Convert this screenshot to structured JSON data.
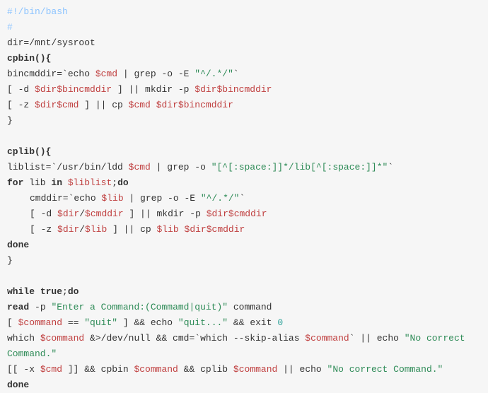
{
  "code": {
    "l1_shebang": "#!/bin/bash",
    "l2_comment": "#",
    "l3a": "dir=",
    "l3b": "/mnt/sysroot",
    "l4": "cpbin(){",
    "l5a": "bincmddir=",
    "l5b": "`echo ",
    "l5c": "$cmd",
    "l5d": " | grep -o -E ",
    "l5e": "\"^/.*/\"",
    "l5f": "`",
    "l6a": "[ -d ",
    "l6b": "$dir$bincmddir",
    "l6c": " ] || mkdir -p ",
    "l6d": "$dir$bincmddir",
    "l7a": "[ -z ",
    "l7b": "$dir$cmd",
    "l7c": " ] || cp ",
    "l7d": "$cmd",
    "l7e": " ",
    "l7f": "$dir$bincmddir",
    "l8": "}",
    "l10": "cplib(){",
    "l11a": "liblist=",
    "l11b": "`/usr/bin/ldd ",
    "l11c": "$cmd",
    "l11d": " | grep -o ",
    "l11e": "\"[^[:space:]]*/lib[^[:space:]]*\"",
    "l11f": "`",
    "l12a": "for",
    "l12b": " lib ",
    "l12c": "in",
    "l12d": " ",
    "l12e": "$liblist",
    "l12f": ";",
    "l12g": "do",
    "l13a": "cmddir=",
    "l13b": "`echo ",
    "l13c": "$lib",
    "l13d": " | grep -o -E ",
    "l13e": "\"^/.*/\"",
    "l13f": "`",
    "l14a": "[ -d ",
    "l14b": "$dir",
    "l14c": "/",
    "l14d": "$cmddir",
    "l14e": " ] || mkdir -p ",
    "l14f": "$dir$cmddir",
    "l15a": "[ -z ",
    "l15b": "$dir",
    "l15c": "/",
    "l15d": "$lib",
    "l15e": " ] || cp ",
    "l15f": "$lib",
    "l15g": " ",
    "l15h": "$dir$cmddir",
    "l16": "done",
    "l17": "}",
    "l19a": "while",
    "l19b": " ",
    "l19c": "true",
    "l19d": ";",
    "l19e": "do",
    "l20a": "read",
    "l20b": " -p ",
    "l20c": "\"Enter a Command:(Commamd|quit)\"",
    "l20d": " command",
    "l21a": "[ ",
    "l21b": "$command",
    "l21c": " == ",
    "l21d": "\"quit\"",
    "l21e": " ] && echo ",
    "l21f": "\"quit...\"",
    "l21g": " && exit ",
    "l21h": "0",
    "l22a": "which ",
    "l22b": "$command",
    "l22c": " &>/dev/null && cmd=",
    "l22d": "`which --skip-alias ",
    "l22e": "$command",
    "l22f": "`",
    "l22g": " || echo ",
    "l22h": "\"No correct Command.\"",
    "l23a": "[[ -x ",
    "l23b": "$cmd",
    "l23c": " ]] && cpbin ",
    "l23d": "$command",
    "l23e": " && cplib ",
    "l23f": "$command",
    "l23g": " || echo ",
    "l23h": "\"No correct Command.\"",
    "l24": "done"
  }
}
